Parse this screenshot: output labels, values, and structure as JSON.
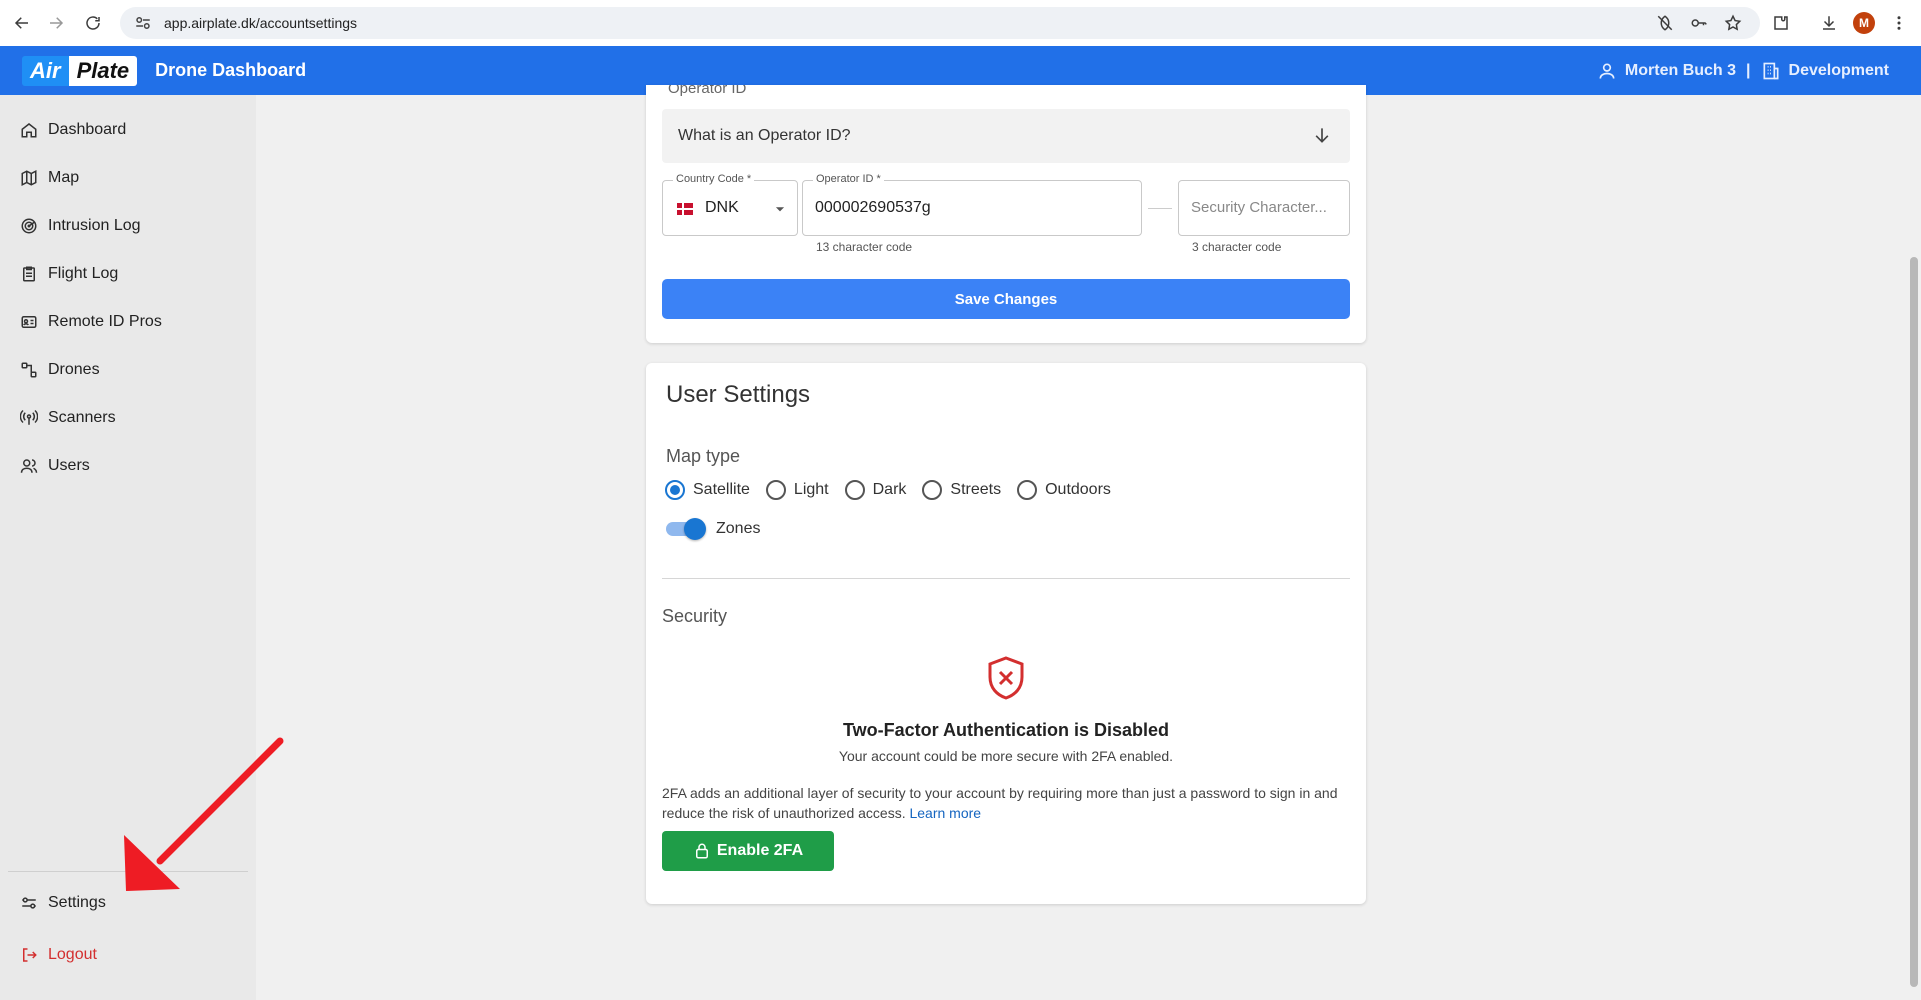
{
  "browser": {
    "url": "app.airplate.dk/accountsettings",
    "profile_initial": "M"
  },
  "header": {
    "logo_air": "Air",
    "logo_plate": "Plate",
    "title": "Drone Dashboard",
    "user_name": "Morten Buch 3",
    "separator": "|",
    "org_name": "Development",
    "color": "#2170e8"
  },
  "sidebar": {
    "items": [
      {
        "label": "Dashboard",
        "icon": "home-icon"
      },
      {
        "label": "Map",
        "icon": "map-icon"
      },
      {
        "label": "Intrusion Log",
        "icon": "radar-icon"
      },
      {
        "label": "Flight Log",
        "icon": "clipboard-icon"
      },
      {
        "label": "Remote ID Pros",
        "icon": "id-card-icon"
      },
      {
        "label": "Drones",
        "icon": "drone-icon"
      },
      {
        "label": "Scanners",
        "icon": "antenna-icon"
      },
      {
        "label": "Users",
        "icon": "users-icon"
      }
    ],
    "settings_label": "Settings",
    "logout_label": "Logout"
  },
  "operator": {
    "cut_label": "Operator ID",
    "faq_question": "What is an Operator ID?",
    "country_label": "Country Code *",
    "country_value": "DNK",
    "operator_label": "Operator ID *",
    "operator_value": "000002690537g",
    "operator_helper": "13 character code",
    "security_placeholder": "Security Character...",
    "security_helper": "3 character code",
    "save_label": "Save Changes"
  },
  "user_settings": {
    "title": "User Settings",
    "map_type_label": "Map type",
    "map_types": [
      {
        "label": "Satellite",
        "checked": true
      },
      {
        "label": "Light",
        "checked": false
      },
      {
        "label": "Dark",
        "checked": false
      },
      {
        "label": "Streets",
        "checked": false
      },
      {
        "label": "Outdoors",
        "checked": false
      }
    ],
    "zones_label": "Zones",
    "zones_on": true
  },
  "security": {
    "title": "Security",
    "status_title": "Two-Factor Authentication is Disabled",
    "status_sub": "Your account could be more secure with 2FA enabled.",
    "description": "2FA adds an additional layer of security to your account by requiring more than just a password to sign in and reduce the risk of unauthorized access.",
    "learn_more": "Learn more",
    "enable_label": "Enable 2FA"
  }
}
